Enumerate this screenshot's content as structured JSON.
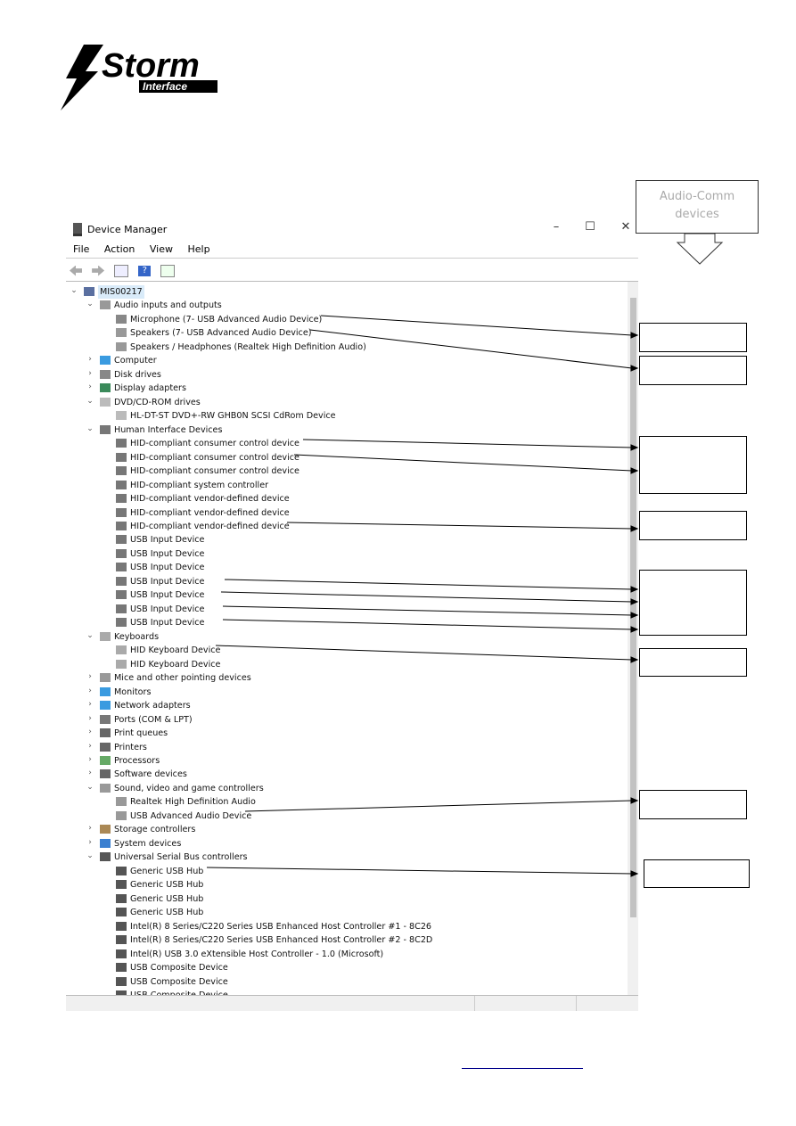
{
  "logo": {
    "text": "Storm",
    "subtext": "Interface"
  },
  "window": {
    "title": "Device Manager",
    "controls": [
      "–",
      "☐",
      "✕"
    ],
    "menu": [
      "File",
      "Action",
      "View",
      "Help"
    ]
  },
  "callout": {
    "text": "Audio-Comm devices"
  },
  "tree": [
    {
      "label": "MIS00217",
      "level": 0,
      "state": "open",
      "icon": "computer-icon",
      "selected": true
    },
    {
      "label": "Audio inputs and outputs",
      "level": 1,
      "state": "open",
      "icon": "speaker-icon"
    },
    {
      "label": "Microphone (7- USB Advanced Audio Device)",
      "level": 2,
      "icon": "microphone-icon"
    },
    {
      "label": "Speakers (7- USB Advanced Audio Device)",
      "level": 2,
      "icon": "speaker-icon"
    },
    {
      "label": "Speakers / Headphones (Realtek High Definition Audio)",
      "level": 2,
      "icon": "speaker-icon"
    },
    {
      "label": "Computer",
      "level": 1,
      "state": "closed",
      "icon": "monitor-icon"
    },
    {
      "label": "Disk drives",
      "level": 1,
      "state": "closed",
      "icon": "disk-icon"
    },
    {
      "label": "Display adapters",
      "level": 1,
      "state": "closed",
      "icon": "display-adapter-icon"
    },
    {
      "label": "DVD/CD-ROM drives",
      "level": 1,
      "state": "open",
      "icon": "dvd-icon"
    },
    {
      "label": "HL-DT-ST DVD+-RW GHB0N SCSI CdRom Device",
      "level": 2,
      "icon": "dvd-icon"
    },
    {
      "label": "Human Interface Devices",
      "level": 1,
      "state": "open",
      "icon": "hid-icon"
    },
    {
      "label": "HID-compliant consumer control device",
      "level": 2,
      "icon": "hid-icon"
    },
    {
      "label": "HID-compliant consumer control device",
      "level": 2,
      "icon": "hid-icon"
    },
    {
      "label": "HID-compliant consumer control device",
      "level": 2,
      "icon": "hid-icon"
    },
    {
      "label": "HID-compliant system controller",
      "level": 2,
      "icon": "hid-icon"
    },
    {
      "label": "HID-compliant vendor-defined device",
      "level": 2,
      "icon": "hid-icon"
    },
    {
      "label": "HID-compliant vendor-defined device",
      "level": 2,
      "icon": "hid-icon"
    },
    {
      "label": "HID-compliant vendor-defined device",
      "level": 2,
      "icon": "hid-icon"
    },
    {
      "label": "USB Input Device",
      "level": 2,
      "icon": "hid-icon"
    },
    {
      "label": "USB Input Device",
      "level": 2,
      "icon": "hid-icon"
    },
    {
      "label": "USB Input Device",
      "level": 2,
      "icon": "hid-icon"
    },
    {
      "label": "USB Input Device",
      "level": 2,
      "icon": "hid-icon"
    },
    {
      "label": "USB Input Device",
      "level": 2,
      "icon": "hid-icon"
    },
    {
      "label": "USB Input Device",
      "level": 2,
      "icon": "hid-icon"
    },
    {
      "label": "USB Input Device",
      "level": 2,
      "icon": "hid-icon"
    },
    {
      "label": "Keyboards",
      "level": 1,
      "state": "open",
      "icon": "keyboard-icon"
    },
    {
      "label": "HID Keyboard Device",
      "level": 2,
      "icon": "keyboard-icon"
    },
    {
      "label": "HID Keyboard Device",
      "level": 2,
      "icon": "keyboard-icon"
    },
    {
      "label": "Mice and other pointing devices",
      "level": 1,
      "state": "closed",
      "icon": "mouse-icon"
    },
    {
      "label": "Monitors",
      "level": 1,
      "state": "closed",
      "icon": "monitor-icon"
    },
    {
      "label": "Network adapters",
      "level": 1,
      "state": "closed",
      "icon": "network-icon"
    },
    {
      "label": "Ports (COM & LPT)",
      "level": 1,
      "state": "closed",
      "icon": "port-icon"
    },
    {
      "label": "Print queues",
      "level": 1,
      "state": "closed",
      "icon": "printer-icon"
    },
    {
      "label": "Printers",
      "level": 1,
      "state": "closed",
      "icon": "printer-icon"
    },
    {
      "label": "Processors",
      "level": 1,
      "state": "closed",
      "icon": "processor-icon"
    },
    {
      "label": "Software devices",
      "level": 1,
      "state": "closed",
      "icon": "software-icon"
    },
    {
      "label": "Sound, video and game controllers",
      "level": 1,
      "state": "open",
      "icon": "speaker-icon"
    },
    {
      "label": "Realtek High Definition Audio",
      "level": 2,
      "icon": "speaker-icon"
    },
    {
      "label": "USB Advanced Audio Device",
      "level": 2,
      "icon": "speaker-icon"
    },
    {
      "label": "Storage controllers",
      "level": 1,
      "state": "closed",
      "icon": "storage-icon"
    },
    {
      "label": "System devices",
      "level": 1,
      "state": "closed",
      "icon": "system-icon"
    },
    {
      "label": "Universal Serial Bus controllers",
      "level": 1,
      "state": "open",
      "icon": "usb-icon"
    },
    {
      "label": "Generic USB Hub",
      "level": 2,
      "icon": "usb-icon"
    },
    {
      "label": "Generic USB Hub",
      "level": 2,
      "icon": "usb-icon"
    },
    {
      "label": "Generic USB Hub",
      "level": 2,
      "icon": "usb-icon"
    },
    {
      "label": "Generic USB Hub",
      "level": 2,
      "icon": "usb-icon"
    },
    {
      "label": "Intel(R) 8 Series/C220 Series USB Enhanced Host Controller #1 - 8C26",
      "level": 2,
      "icon": "usb-icon"
    },
    {
      "label": "Intel(R) 8 Series/C220 Series USB Enhanced Host Controller #2 - 8C2D",
      "level": 2,
      "icon": "usb-icon"
    },
    {
      "label": "Intel(R) USB 3.0 eXtensible Host Controller - 1.0 (Microsoft)",
      "level": 2,
      "icon": "usb-icon"
    },
    {
      "label": "USB Composite Device",
      "level": 2,
      "icon": "usb-icon"
    },
    {
      "label": "USB Composite Device",
      "level": 2,
      "icon": "usb-icon"
    },
    {
      "label": "USB Composite Device",
      "level": 2,
      "icon": "usb-icon"
    }
  ]
}
